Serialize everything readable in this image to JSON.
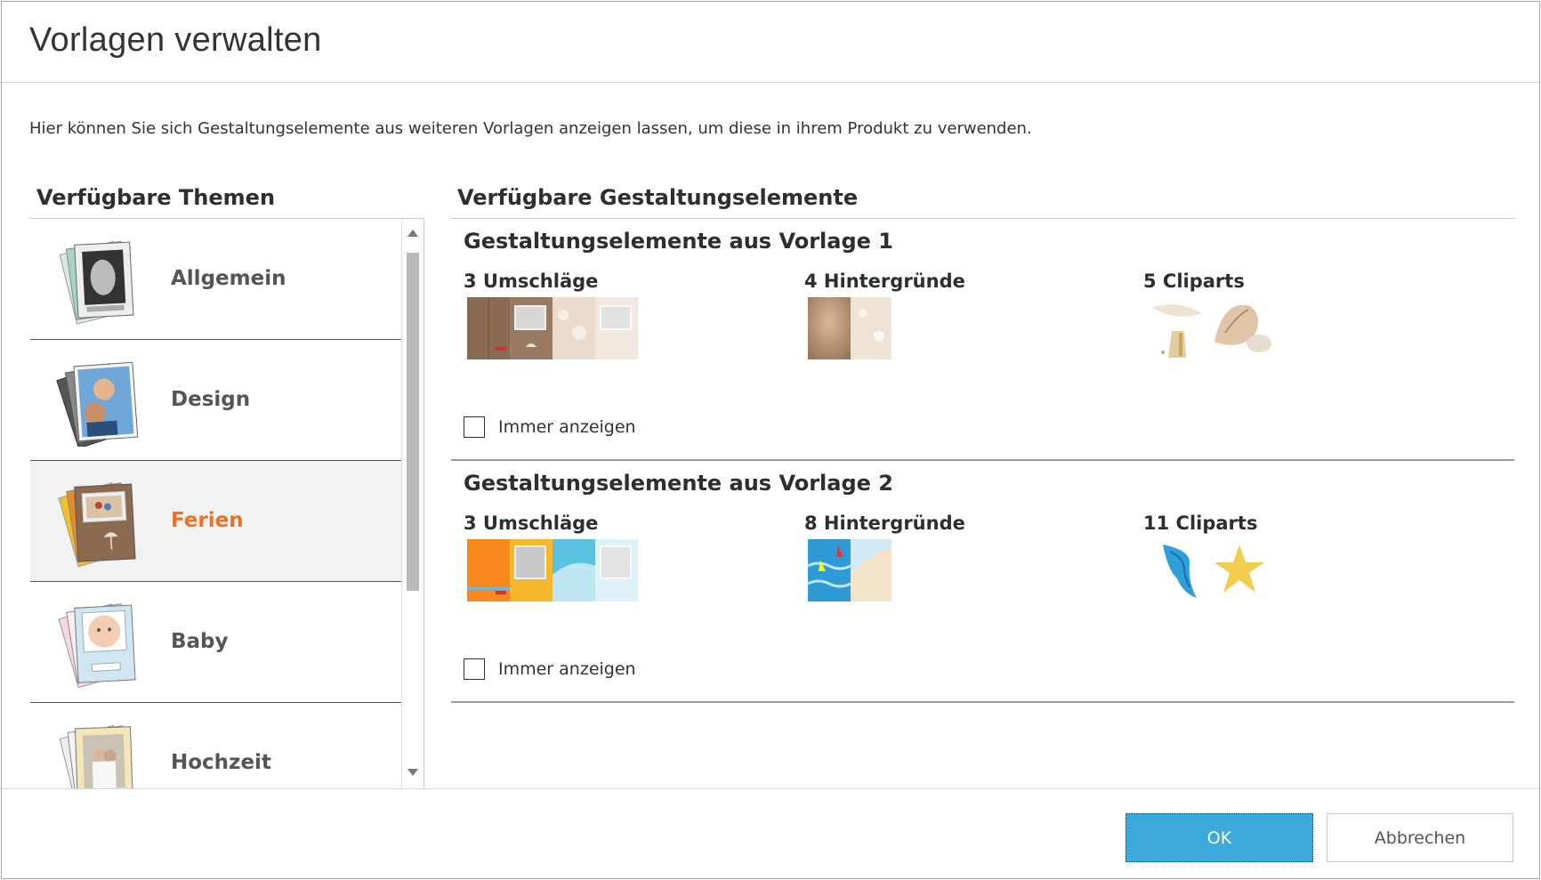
{
  "dialog": {
    "title": "Vorlagen verwalten",
    "intro": "Hier können Sie sich Gestaltungselemente aus weiteren Vorlagen anzeigen lassen, um diese in ihrem Produkt zu verwenden."
  },
  "left": {
    "heading": "Verfügbare Themen",
    "themes": [
      {
        "label": "Allgemein",
        "selected": false
      },
      {
        "label": "Design",
        "selected": false
      },
      {
        "label": "Ferien",
        "selected": true
      },
      {
        "label": "Baby",
        "selected": false
      },
      {
        "label": "Hochzeit",
        "selected": false
      }
    ]
  },
  "right": {
    "heading": "Verfügbare Gestaltungselemente",
    "vorlagen": [
      {
        "title": "Gestaltungselemente aus Vorlage 1",
        "umschlaege": "3 Umschläge",
        "hintergruende": "4 Hintergründe",
        "cliparts": "5 Cliparts",
        "immer_anzeigen": "Immer anzeigen",
        "immer_checked": false
      },
      {
        "title": "Gestaltungselemente aus Vorlage 2",
        "umschlaege": "3 Umschläge",
        "hintergruende": "8 Hintergründe",
        "cliparts": "11 Cliparts",
        "immer_anzeigen": "Immer anzeigen",
        "immer_checked": false
      }
    ]
  },
  "footer": {
    "ok_label": "OK",
    "cancel_label": "Abbrechen"
  },
  "colors": {
    "accent_orange": "#e8732a",
    "ok_blue": "#3ba9d9"
  },
  "icons": [
    "scroll-up-arrow-icon",
    "scroll-down-arrow-icon",
    "checkbox-icon"
  ]
}
